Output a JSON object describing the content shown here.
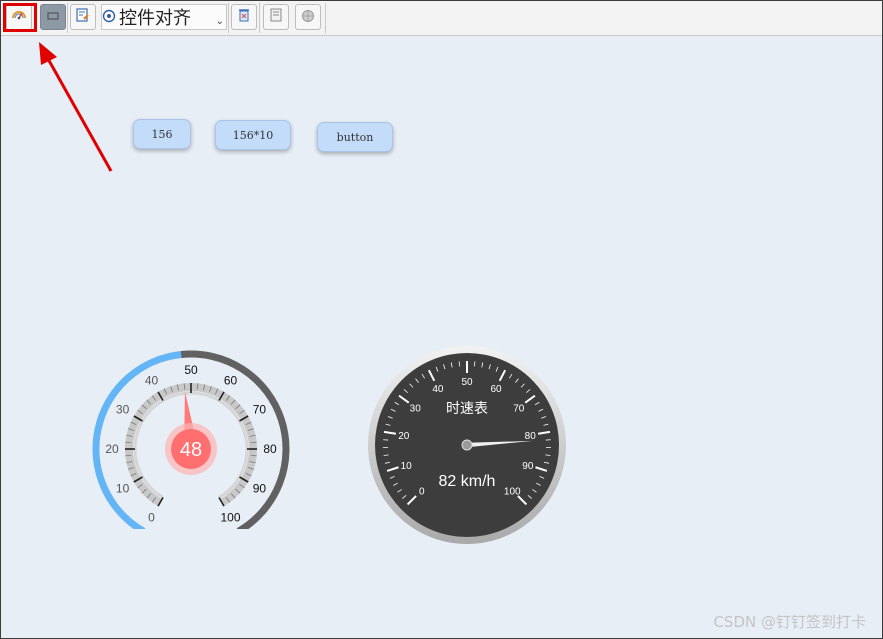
{
  "toolbar": {
    "align_dropdown": {
      "selected": "控件对齐"
    },
    "buttons": [
      "gauge-tool",
      "rectangle-tool",
      "edit-properties",
      "align-target",
      "delete",
      "preview",
      "publish"
    ]
  },
  "canvas_buttons": [
    {
      "label": "156"
    },
    {
      "label": "156*10"
    },
    {
      "label": "button"
    }
  ],
  "gauge_left": {
    "value": "48",
    "value_fraction": 0.48,
    "ticks": [
      "0",
      "10",
      "20",
      "30",
      "40",
      "50",
      "60",
      "70",
      "80",
      "90",
      "100"
    ],
    "colors": {
      "progress": "#64b5f6",
      "track": "#616161",
      "needle": "#ff7b7b",
      "center": "#ff6f6f"
    }
  },
  "gauge_right": {
    "title": "时速表",
    "readout": "82 km/h",
    "value": 82,
    "ticks": [
      "0",
      "10",
      "20",
      "30",
      "40",
      "50",
      "60",
      "70",
      "80",
      "90",
      "100"
    ],
    "colors": {
      "face": "#3d3d3d",
      "bezel": "#c8c8c8",
      "needle": "#f0f0f0"
    }
  },
  "watermark": "CSDN @钉钉签到打卡",
  "annotation": {
    "color": "#e00000"
  }
}
